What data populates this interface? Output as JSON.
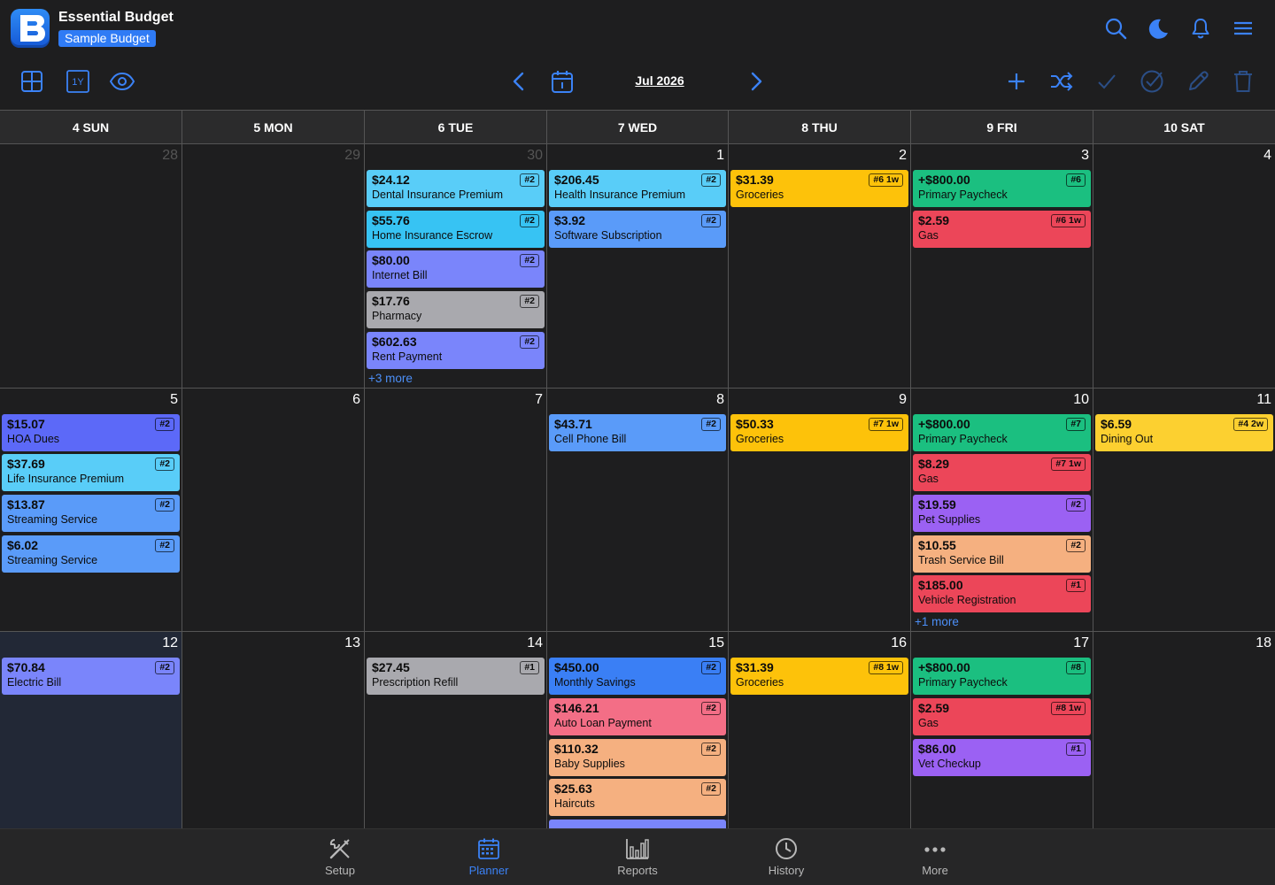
{
  "app": {
    "title": "Essential Budget",
    "budget_name": "Sample Budget"
  },
  "toolbar": {
    "month_label": "Jul 2026",
    "year_view_label": "1Y"
  },
  "calendar": {
    "day_headers": [
      "4 SUN",
      "5 MON",
      "6 TUE",
      "7 WED",
      "8 THU",
      "9 FRI",
      "10 SAT"
    ],
    "day_numbers": [
      "28",
      "29",
      "30",
      "1",
      "2",
      "3",
      "4",
      "5",
      "6",
      "7",
      "8",
      "9",
      "10",
      "11",
      "12",
      "13",
      "14",
      "15",
      "16",
      "17",
      "18"
    ],
    "more_links": {
      "tue_week1": "+3 more",
      "fri_week2": "+1 more"
    },
    "events": [
      {
        "amount": "$24.12",
        "desc": "Dental Insurance Premium",
        "tag": "#2"
      },
      {
        "amount": "$55.76",
        "desc": "Home Insurance Escrow",
        "tag": "#2"
      },
      {
        "amount": "$80.00",
        "desc": "Internet Bill",
        "tag": "#2"
      },
      {
        "amount": "$17.76",
        "desc": "Pharmacy",
        "tag": "#2"
      },
      {
        "amount": "$602.63",
        "desc": "Rent Payment",
        "tag": "#2"
      },
      {
        "amount": "$206.45",
        "desc": "Health Insurance Premium",
        "tag": "#2"
      },
      {
        "amount": "$3.92",
        "desc": "Software Subscription",
        "tag": "#2"
      },
      {
        "amount": "$31.39",
        "desc": "Groceries",
        "tag": "#6 1w"
      },
      {
        "amount": "+$800.00",
        "desc": "Primary Paycheck",
        "tag": "#6"
      },
      {
        "amount": "$2.59",
        "desc": "Gas",
        "tag": "#6 1w"
      },
      {
        "amount": "$15.07",
        "desc": "HOA Dues",
        "tag": "#2"
      },
      {
        "amount": "$37.69",
        "desc": "Life Insurance Premium",
        "tag": "#2"
      },
      {
        "amount": "$13.87",
        "desc": "Streaming Service",
        "tag": "#2"
      },
      {
        "amount": "$6.02",
        "desc": "Streaming Service",
        "tag": "#2"
      },
      {
        "amount": "$43.71",
        "desc": "Cell Phone Bill",
        "tag": "#2"
      },
      {
        "amount": "$50.33",
        "desc": "Groceries",
        "tag": "#7 1w"
      },
      {
        "amount": "+$800.00",
        "desc": "Primary Paycheck",
        "tag": "#7"
      },
      {
        "amount": "$8.29",
        "desc": "Gas",
        "tag": "#7 1w"
      },
      {
        "amount": "$19.59",
        "desc": "Pet Supplies",
        "tag": "#2"
      },
      {
        "amount": "$10.55",
        "desc": "Trash Service Bill",
        "tag": "#2"
      },
      {
        "amount": "$185.00",
        "desc": "Vehicle Registration",
        "tag": "#1"
      },
      {
        "amount": "$6.59",
        "desc": "Dining Out",
        "tag": "#4 2w"
      },
      {
        "amount": "$70.84",
        "desc": "Electric Bill",
        "tag": "#2"
      },
      {
        "amount": "$27.45",
        "desc": "Prescription Refill",
        "tag": "#1"
      },
      {
        "amount": "$450.00",
        "desc": "Monthly Savings",
        "tag": "#2"
      },
      {
        "amount": "$146.21",
        "desc": "Auto Loan Payment",
        "tag": "#2"
      },
      {
        "amount": "$110.32",
        "desc": "Baby Supplies",
        "tag": "#2"
      },
      {
        "amount": "$25.63",
        "desc": "Haircuts",
        "tag": "#2"
      },
      {
        "amount": "$31.39",
        "desc": "Groceries",
        "tag": "#8 1w"
      },
      {
        "amount": "+$800.00",
        "desc": "Primary Paycheck",
        "tag": "#8"
      },
      {
        "amount": "$2.59",
        "desc": "Gas",
        "tag": "#8 1w"
      },
      {
        "amount": "$86.00",
        "desc": "Vet Checkup",
        "tag": "#1"
      }
    ]
  },
  "colors": {
    "cyan": "#59cdf8",
    "sky": "#37c3f3",
    "periwinkle": "#7a85fb",
    "gray": "#a9a9ae",
    "blue": "#5a9bf9",
    "yellow": "#fdc20a",
    "green": "#1bbf80",
    "red": "#ec4659",
    "violet": "#5c69f8",
    "purple": "#9b61f3",
    "peach": "#f5b080",
    "pink": "#f36e86",
    "royal": "#3a7ff5",
    "accent": "#3b82f6"
  },
  "nav": {
    "setup": "Setup",
    "planner": "Planner",
    "reports": "Reports",
    "history": "History",
    "more": "More"
  }
}
